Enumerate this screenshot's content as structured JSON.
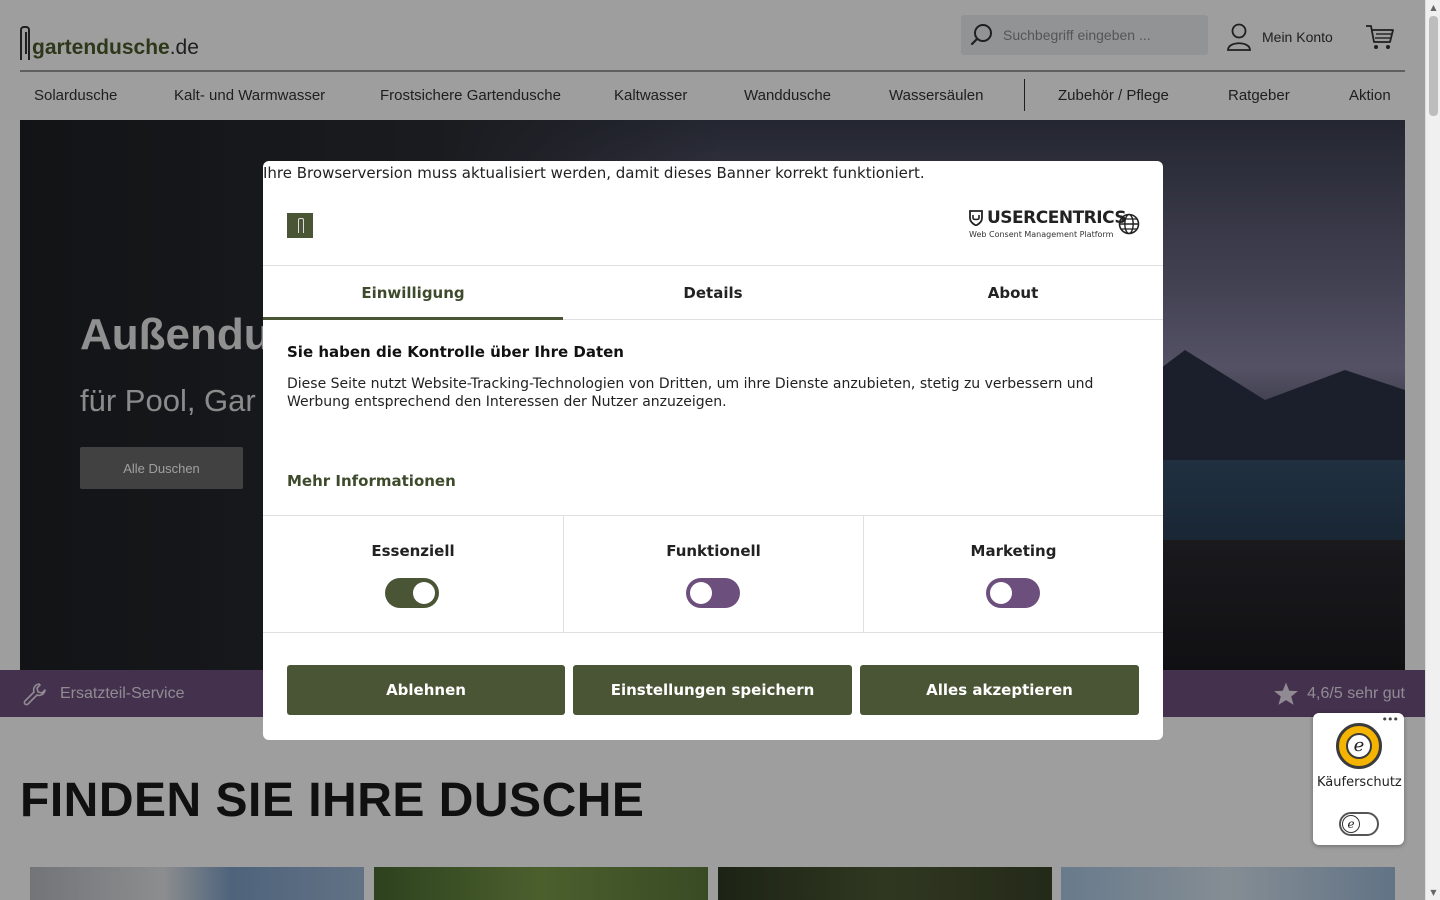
{
  "header": {
    "logo": {
      "brand": "gartendusche",
      "tld": ".de"
    },
    "search": {
      "placeholder": "Suchbegriff eingeben ...",
      "icon": "search-icon"
    },
    "account_label": "Mein Konto",
    "cart_icon": "cart-icon"
  },
  "nav": {
    "items": [
      "Solardusche",
      "Kalt- und Warmwasser",
      "Frostsichere Gartendusche",
      "Kaltwasser",
      "Wanddusche",
      "Wassersäulen",
      "Zubehör / Pflege",
      "Ratgeber",
      "Aktion"
    ]
  },
  "hero": {
    "title": "Außendu",
    "subtitle": "für Pool, Gar",
    "button_label": "Alle Duschen"
  },
  "strip": {
    "spare_parts": "Ersatzteil-Service",
    "rating": "4,6/5 sehr gut"
  },
  "section": {
    "heading": "FINDEN SIE IHRE DUSCHE"
  },
  "consent": {
    "browser_notice": "Ihre Browserversion muss aktualisiert werden, damit dieses Banner korrekt funktioniert.",
    "provider": {
      "name": "USERCENTRICS",
      "tagline": "Web Consent Management Platform"
    },
    "tabs": [
      {
        "label": "Einwilligung",
        "active": true
      },
      {
        "label": "Details",
        "active": false
      },
      {
        "label": "About",
        "active": false
      }
    ],
    "heading": "Sie haben die Kontrolle über Ihre Daten",
    "body": "Diese Seite nutzt Website-Tracking-Technologien von Dritten, um ihre Dienste anzubieten, stetig zu verbessern und Werbung entsprechend den Interessen der Nutzer anzuzeigen.",
    "more_info": "Mehr Informationen",
    "categories": [
      {
        "label": "Essenziell",
        "enabled": true
      },
      {
        "label": "Funktionell",
        "enabled": false
      },
      {
        "label": "Marketing",
        "enabled": false
      }
    ],
    "buttons": {
      "decline": "Ablehnen",
      "save": "Einstellungen speichern",
      "accept_all": "Alles akzeptieren"
    }
  },
  "trusted_shops": {
    "label": "Käuferschutz",
    "dots": "•••",
    "seal_letter": "e"
  },
  "colors": {
    "primary_green": "#4a5535",
    "accent_purple": "#6e4f7e",
    "overlay": "rgba(0,0,0,0.38)"
  }
}
